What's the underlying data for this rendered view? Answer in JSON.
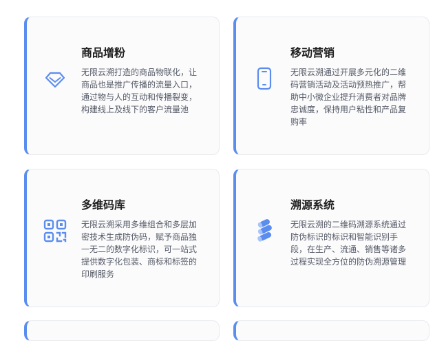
{
  "accent_color": "#5b8def",
  "cards": [
    {
      "title": "商品增粉",
      "icon": "diamond-icon",
      "description": "无限云溯打造的商品物联化，让商品也是推广传播的流量入口，通过物与人的互动和传播裂变，构建线上及线下的客户流量池"
    },
    {
      "title": "移动营销",
      "icon": "smartphone-icon",
      "description": "无限云溯通过开展多元化的二维码营销活动及活动预热推广，帮助中小微企业提升消费者对品牌忠诚度，保持用户粘性和产品复购率"
    },
    {
      "title": "多维码库",
      "icon": "qr-code-icon",
      "description": "无限云溯采用多维组合和多层加密技术生成防伪码，赋予商品独一无二的数字化标识，可一站式提供数字化包装、商标和标签的印刷服务"
    },
    {
      "title": "溯源系统",
      "icon": "pipes-icon",
      "description": "无限云溯的二维码溯源系统通过防伪标识的标识和智能识别手段，在生产、流通、销售等诸多过程实现全方位的防伪溯源管理"
    }
  ]
}
